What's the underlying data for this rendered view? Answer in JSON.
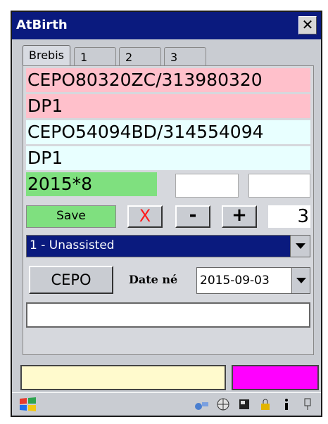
{
  "window": {
    "title": "AtBirth",
    "close_label": "✕"
  },
  "tabs": [
    {
      "label": "Brebis",
      "active": true
    },
    {
      "label": "1",
      "active": false
    },
    {
      "label": "2",
      "active": false
    },
    {
      "label": "3",
      "active": false
    }
  ],
  "fields": {
    "line1": "CEPO80320ZC/313980320",
    "line2": "DP1",
    "line3": "CEPO54094BD/314554094",
    "line4": "DP1",
    "line5": "2015*8"
  },
  "controls": {
    "save_label": "Save",
    "delete_label": "X",
    "minus_label": "-",
    "plus_label": "+",
    "count": "3",
    "assistance_value": "1 - Unassisted",
    "cepo_label": "CEPO",
    "date_label": "Date né",
    "date_value": "2015-09-03"
  },
  "colors": {
    "pink": "#ffc0cb",
    "cyan": "#e8ffff",
    "green": "#7fe07f",
    "yellow": "#fffacd",
    "magenta": "#ff00ff",
    "title": "#0a1a7e"
  },
  "taskbar": {
    "start_icon": "windows-logo-icon",
    "tray_icons": [
      "network-icon",
      "globe-icon",
      "card-icon",
      "lock-icon",
      "info-icon",
      "power-icon"
    ]
  }
}
